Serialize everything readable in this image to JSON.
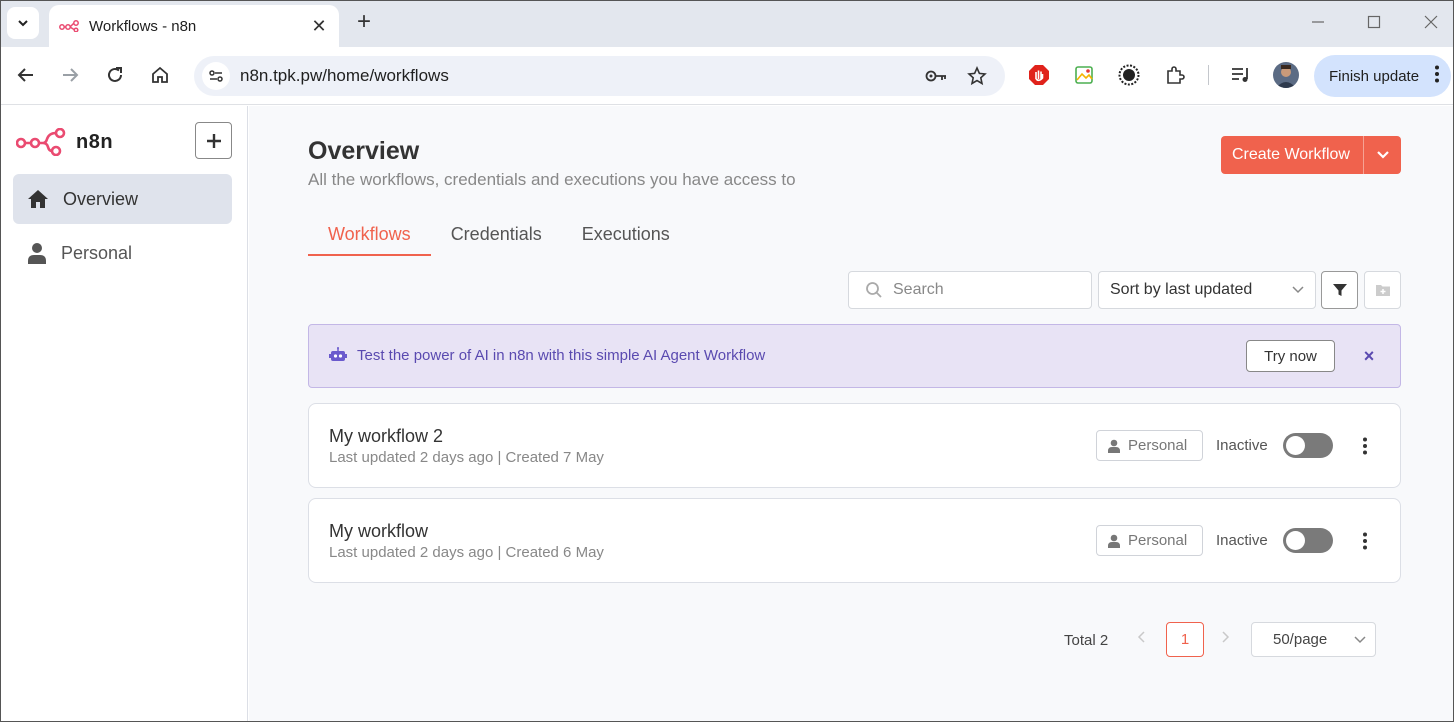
{
  "browser": {
    "tab_title": "Workflows - n8n",
    "url": "n8n.tpk.pw/home/workflows",
    "finish_update_label": "Finish update"
  },
  "sidebar": {
    "brand": "n8n",
    "items": [
      {
        "label": "Overview",
        "icon": "home-icon",
        "active": true
      },
      {
        "label": "Personal",
        "icon": "user-icon",
        "active": false
      }
    ]
  },
  "header": {
    "title": "Overview",
    "subtitle": "All the workflows, credentials and executions you have access to",
    "create_label": "Create Workflow"
  },
  "tabs": [
    {
      "label": "Workflows",
      "active": true
    },
    {
      "label": "Credentials",
      "active": false
    },
    {
      "label": "Executions",
      "active": false
    }
  ],
  "filters": {
    "search_placeholder": "Search",
    "sort_label": "Sort by last updated"
  },
  "banner": {
    "text": "Test the power of AI in n8n with this simple AI Agent Workflow",
    "button_label": "Try now",
    "close": "×"
  },
  "workflows": [
    {
      "name": "My workflow 2",
      "meta": "Last updated 2 days ago | Created 7 May",
      "owner": "Personal",
      "status": "Inactive",
      "active": false
    },
    {
      "name": "My workflow",
      "meta": "Last updated 2 days ago | Created 6 May",
      "owner": "Personal",
      "status": "Inactive",
      "active": false
    }
  ],
  "pagination": {
    "total_label": "Total 2",
    "current_page": "1",
    "page_size": "50/page"
  },
  "colors": {
    "accent": "#f0624d",
    "banner_bg": "#e8e3f5",
    "banner_text": "#5a4ab0"
  }
}
